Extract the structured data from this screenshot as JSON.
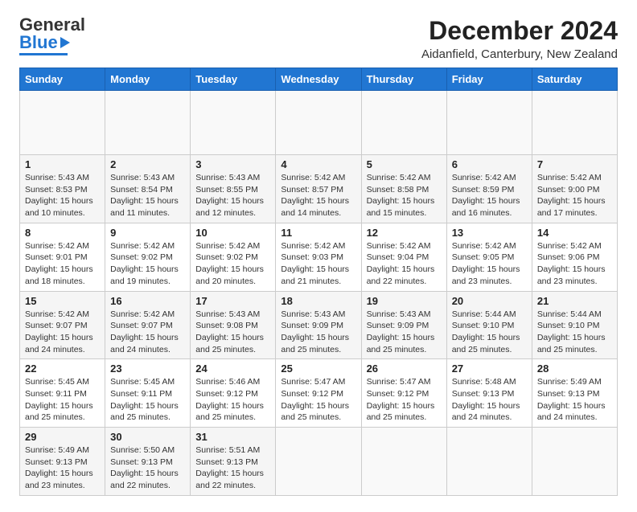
{
  "header": {
    "logo_general": "General",
    "logo_blue": "Blue",
    "month_title": "December 2024",
    "location": "Aidanfield, Canterbury, New Zealand"
  },
  "calendar": {
    "days_of_week": [
      "Sunday",
      "Monday",
      "Tuesday",
      "Wednesday",
      "Thursday",
      "Friday",
      "Saturday"
    ],
    "weeks": [
      [
        {
          "day": "",
          "content": ""
        },
        {
          "day": "",
          "content": ""
        },
        {
          "day": "",
          "content": ""
        },
        {
          "day": "",
          "content": ""
        },
        {
          "day": "",
          "content": ""
        },
        {
          "day": "",
          "content": ""
        },
        {
          "day": "",
          "content": ""
        }
      ],
      [
        {
          "day": "1",
          "content": "Sunrise: 5:43 AM\nSunset: 8:53 PM\nDaylight: 15 hours\nand 10 minutes."
        },
        {
          "day": "2",
          "content": "Sunrise: 5:43 AM\nSunset: 8:54 PM\nDaylight: 15 hours\nand 11 minutes."
        },
        {
          "day": "3",
          "content": "Sunrise: 5:43 AM\nSunset: 8:55 PM\nDaylight: 15 hours\nand 12 minutes."
        },
        {
          "day": "4",
          "content": "Sunrise: 5:42 AM\nSunset: 8:57 PM\nDaylight: 15 hours\nand 14 minutes."
        },
        {
          "day": "5",
          "content": "Sunrise: 5:42 AM\nSunset: 8:58 PM\nDaylight: 15 hours\nand 15 minutes."
        },
        {
          "day": "6",
          "content": "Sunrise: 5:42 AM\nSunset: 8:59 PM\nDaylight: 15 hours\nand 16 minutes."
        },
        {
          "day": "7",
          "content": "Sunrise: 5:42 AM\nSunset: 9:00 PM\nDaylight: 15 hours\nand 17 minutes."
        }
      ],
      [
        {
          "day": "8",
          "content": "Sunrise: 5:42 AM\nSunset: 9:01 PM\nDaylight: 15 hours\nand 18 minutes."
        },
        {
          "day": "9",
          "content": "Sunrise: 5:42 AM\nSunset: 9:02 PM\nDaylight: 15 hours\nand 19 minutes."
        },
        {
          "day": "10",
          "content": "Sunrise: 5:42 AM\nSunset: 9:02 PM\nDaylight: 15 hours\nand 20 minutes."
        },
        {
          "day": "11",
          "content": "Sunrise: 5:42 AM\nSunset: 9:03 PM\nDaylight: 15 hours\nand 21 minutes."
        },
        {
          "day": "12",
          "content": "Sunrise: 5:42 AM\nSunset: 9:04 PM\nDaylight: 15 hours\nand 22 minutes."
        },
        {
          "day": "13",
          "content": "Sunrise: 5:42 AM\nSunset: 9:05 PM\nDaylight: 15 hours\nand 23 minutes."
        },
        {
          "day": "14",
          "content": "Sunrise: 5:42 AM\nSunset: 9:06 PM\nDaylight: 15 hours\nand 23 minutes."
        }
      ],
      [
        {
          "day": "15",
          "content": "Sunrise: 5:42 AM\nSunset: 9:07 PM\nDaylight: 15 hours\nand 24 minutes."
        },
        {
          "day": "16",
          "content": "Sunrise: 5:42 AM\nSunset: 9:07 PM\nDaylight: 15 hours\nand 24 minutes."
        },
        {
          "day": "17",
          "content": "Sunrise: 5:43 AM\nSunset: 9:08 PM\nDaylight: 15 hours\nand 25 minutes."
        },
        {
          "day": "18",
          "content": "Sunrise: 5:43 AM\nSunset: 9:09 PM\nDaylight: 15 hours\nand 25 minutes."
        },
        {
          "day": "19",
          "content": "Sunrise: 5:43 AM\nSunset: 9:09 PM\nDaylight: 15 hours\nand 25 minutes."
        },
        {
          "day": "20",
          "content": "Sunrise: 5:44 AM\nSunset: 9:10 PM\nDaylight: 15 hours\nand 25 minutes."
        },
        {
          "day": "21",
          "content": "Sunrise: 5:44 AM\nSunset: 9:10 PM\nDaylight: 15 hours\nand 25 minutes."
        }
      ],
      [
        {
          "day": "22",
          "content": "Sunrise: 5:45 AM\nSunset: 9:11 PM\nDaylight: 15 hours\nand 25 minutes."
        },
        {
          "day": "23",
          "content": "Sunrise: 5:45 AM\nSunset: 9:11 PM\nDaylight: 15 hours\nand 25 minutes."
        },
        {
          "day": "24",
          "content": "Sunrise: 5:46 AM\nSunset: 9:12 PM\nDaylight: 15 hours\nand 25 minutes."
        },
        {
          "day": "25",
          "content": "Sunrise: 5:47 AM\nSunset: 9:12 PM\nDaylight: 15 hours\nand 25 minutes."
        },
        {
          "day": "26",
          "content": "Sunrise: 5:47 AM\nSunset: 9:12 PM\nDaylight: 15 hours\nand 25 minutes."
        },
        {
          "day": "27",
          "content": "Sunrise: 5:48 AM\nSunset: 9:13 PM\nDaylight: 15 hours\nand 24 minutes."
        },
        {
          "day": "28",
          "content": "Sunrise: 5:49 AM\nSunset: 9:13 PM\nDaylight: 15 hours\nand 24 minutes."
        }
      ],
      [
        {
          "day": "29",
          "content": "Sunrise: 5:49 AM\nSunset: 9:13 PM\nDaylight: 15 hours\nand 23 minutes."
        },
        {
          "day": "30",
          "content": "Sunrise: 5:50 AM\nSunset: 9:13 PM\nDaylight: 15 hours\nand 22 minutes."
        },
        {
          "day": "31",
          "content": "Sunrise: 5:51 AM\nSunset: 9:13 PM\nDaylight: 15 hours\nand 22 minutes."
        },
        {
          "day": "",
          "content": ""
        },
        {
          "day": "",
          "content": ""
        },
        {
          "day": "",
          "content": ""
        },
        {
          "day": "",
          "content": ""
        }
      ]
    ]
  }
}
